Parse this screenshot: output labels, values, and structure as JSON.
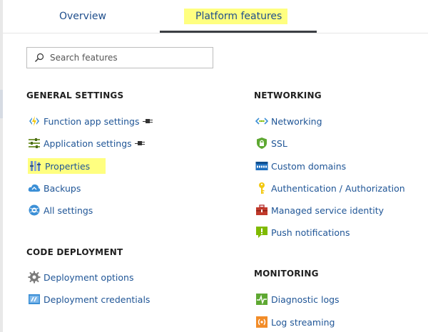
{
  "tabs": {
    "overview": "Overview",
    "platform": "Platform features"
  },
  "search": {
    "placeholder": "Search features"
  },
  "general": {
    "title": "GENERAL SETTINGS",
    "items": [
      "Function app settings",
      "Application settings",
      "Properties",
      "Backups",
      "All settings"
    ]
  },
  "code_deployment": {
    "title": "CODE DEPLOYMENT",
    "items": [
      "Deployment options",
      "Deployment credentials"
    ]
  },
  "networking": {
    "title": "NETWORKING",
    "items": [
      "Networking",
      "SSL",
      "Custom domains",
      "Authentication / Authorization",
      "Managed service identity",
      "Push notifications"
    ]
  },
  "monitoring": {
    "title": "MONITORING",
    "items": [
      "Diagnostic logs",
      "Log streaming"
    ]
  },
  "colors": {
    "highlight": "#ffff80",
    "link": "#1f5596",
    "tab_underline": "#3c3f44"
  }
}
